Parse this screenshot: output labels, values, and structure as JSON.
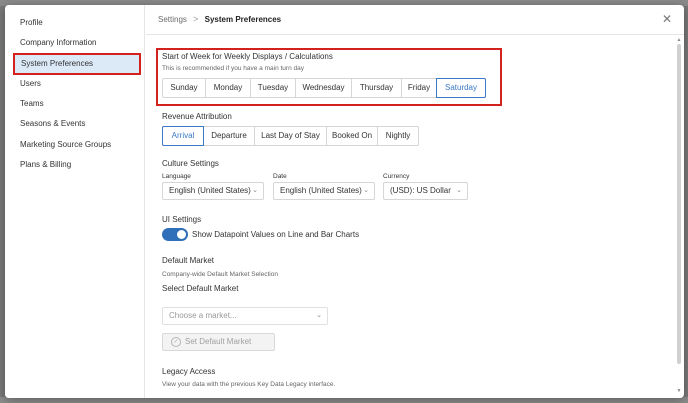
{
  "sidebar": {
    "items": [
      {
        "label": "Profile"
      },
      {
        "label": "Company Information"
      },
      {
        "label": "System Preferences"
      },
      {
        "label": "Users"
      },
      {
        "label": "Teams"
      },
      {
        "label": "Seasons & Events"
      },
      {
        "label": "Marketing Source Groups"
      },
      {
        "label": "Plans & Billing"
      }
    ],
    "active_index": 2
  },
  "header": {
    "breadcrumb_root": "Settings",
    "breadcrumb_sep": ">",
    "breadcrumb_current": "System Preferences",
    "close_glyph": "✕"
  },
  "week": {
    "title": "Start of Week for Weekly Displays / Calculations",
    "subtitle": "This is recommended if you have a main turn day",
    "days": [
      "Sunday",
      "Monday",
      "Tuesday",
      "Wednesday",
      "Thursday",
      "Friday",
      "Saturday"
    ],
    "selected": "Saturday"
  },
  "revenue": {
    "title": "Revenue Attribution",
    "options": [
      "Arrival",
      "Departure",
      "Last Day of Stay",
      "Booked On",
      "Nightly"
    ],
    "selected": "Arrival"
  },
  "culture": {
    "title": "Culture Settings",
    "language_label": "Language",
    "language_value": "English (United States)",
    "date_label": "Date",
    "date_value": "English (United States)",
    "currency_label": "Currency",
    "currency_value": "(USD): US Dollar",
    "chevron_glyph": "⌄"
  },
  "ui": {
    "title": "UI Settings",
    "toggle_label": "Show Datapoint Values on Line and Bar Charts",
    "toggle_on": true
  },
  "market": {
    "title": "Default Market",
    "subtitle": "Company-wide Default Market Selection",
    "select_title": "Select Default Market",
    "placeholder": "Choose a market...",
    "set_button": "Set Default Market",
    "check_glyph": "✓"
  },
  "legacy": {
    "title": "Legacy Access",
    "subtitle": "View your data with the previous Key Data Legacy interface."
  },
  "scrollbar": {
    "up_glyph": "▲",
    "down_glyph": "▼"
  },
  "colors": {
    "accent": "#3a79c4",
    "highlight_border": "#d3211d",
    "active_bg": "#dce9f7",
    "toggle_on": "#2f6fb9"
  }
}
